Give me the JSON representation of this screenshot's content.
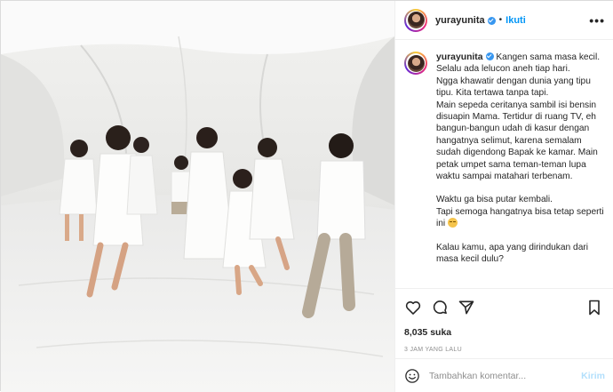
{
  "post": {
    "username": "yurayunita",
    "follow_label": "Ikuti",
    "separator": "•",
    "more_label": "•••"
  },
  "caption": {
    "username": "yurayunita",
    "lines": [
      "Kangen sama masa kecil.",
      "Selalu ada lelucon aneh tiap hari.",
      "Ngga khawatir dengan dunia yang tipu tipu. Kita tertawa tanpa tapi.",
      "Main sepeda ceritanya sambil isi bensin disuapin Mama. Tertidur di ruang TV, eh bangun-bangun udah di kasur dengan hangatnya selimut, karena semalam sudah digendong Bapak ke kamar. Main petak umpet sama teman-teman lupa waktu sampai matahari terbenam.",
      "Waktu ga bisa putar kembali.",
      "Tapi semoga hangatnya bisa tetap seperti ini",
      "Kalau kamu, apa yang dirindukan dari masa kecil dulu?"
    ]
  },
  "actions": {
    "icons": [
      "heart-icon",
      "comment-icon",
      "share-icon",
      "bookmark-icon"
    ],
    "likes": "8,035 suka",
    "timestamp": "3 JAM YANG LALU"
  },
  "comment_box": {
    "placeholder": "Tambahkan komentar...",
    "post_label": "Kirim",
    "icon": "smile-icon"
  },
  "colors": {
    "link_blue": "#0095f6",
    "post_disabled": "#b2dffc",
    "verified": "#3897f0"
  }
}
